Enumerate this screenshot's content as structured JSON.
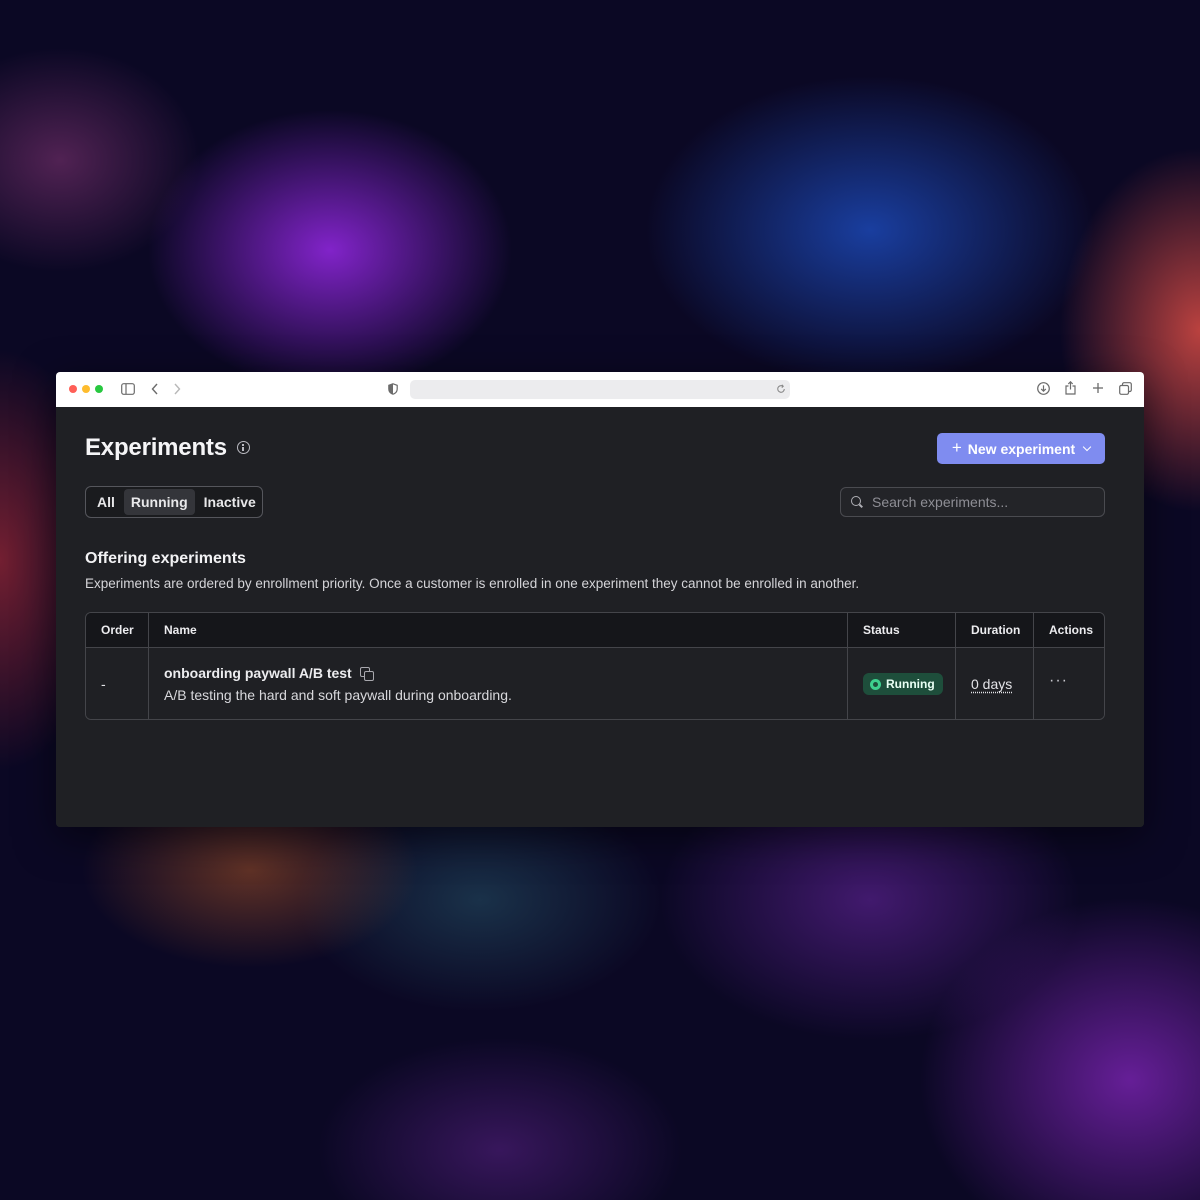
{
  "page": {
    "title": "Experiments",
    "new_button_label": "New experiment",
    "filters": [
      "All",
      "Running",
      "Inactive"
    ],
    "active_filter": "Running",
    "search_placeholder": "Search experiments..."
  },
  "section": {
    "title": "Offering experiments",
    "description": "Experiments are ordered by enrollment priority. Once a customer is enrolled in one experiment they cannot be enrolled in another."
  },
  "table": {
    "headers": {
      "order": "Order",
      "name": "Name",
      "status": "Status",
      "duration": "Duration",
      "actions": "Actions"
    },
    "rows": [
      {
        "order": "-",
        "name": "onboarding paywall A/B test",
        "description": "A/B testing the hard and soft paywall during onboarding.",
        "status": "Running",
        "duration": "0 days",
        "actions": "···"
      }
    ]
  },
  "colors": {
    "accent": "#7f8cf0",
    "status_running_bg": "#1e4e3b",
    "status_running_icon": "#3ecf8e",
    "traffic_red": "#ff5f57",
    "traffic_yellow": "#febc2e",
    "traffic_green": "#28c840"
  }
}
